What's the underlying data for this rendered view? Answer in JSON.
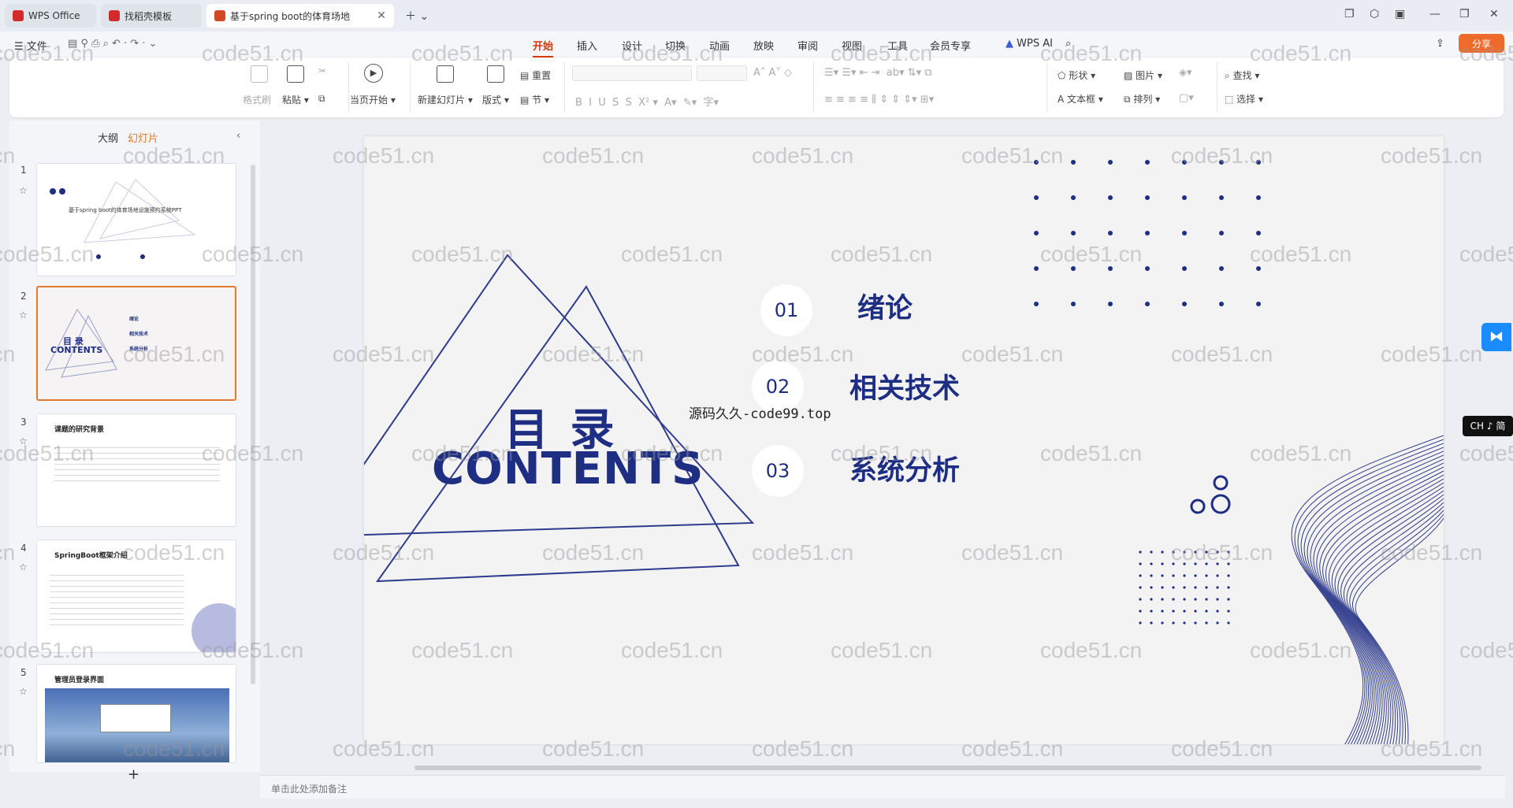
{
  "tabs": [
    {
      "label": "WPS Office",
      "color": "#d12b2b"
    },
    {
      "label": "找稻壳模板",
      "color": "#d12b2b"
    },
    {
      "label": "基于spring boot的体育场地",
      "color": "#d24726"
    }
  ],
  "menu": {
    "file": "文件",
    "items": [
      "开始",
      "插入",
      "设计",
      "切换",
      "动画",
      "放映",
      "审阅",
      "视图",
      "工具",
      "会员专享"
    ],
    "active": "开始",
    "wps_ai": "WPS AI",
    "share": "分享"
  },
  "ribbon": {
    "format_painter": "格式刷",
    "paste": "粘贴",
    "from_current": "当页开始",
    "new_slide": "新建幻灯片",
    "layout": "版式",
    "reset": "重置",
    "section": "节",
    "shape": "形状",
    "picture": "图片",
    "find": "查找",
    "textbox": "文本框",
    "arrange": "排列",
    "select": "选择"
  },
  "panel": {
    "outline": "大纲",
    "slides": "幻灯片",
    "add": "+"
  },
  "thumbs": [
    {
      "num": "1",
      "title": "基于spring boot的体育场地设施预约系统PPT"
    },
    {
      "num": "2",
      "title_cn": "目 录",
      "title_en": "CONTENTS",
      "items": [
        "绪论",
        "相关技术",
        "系统分析"
      ]
    },
    {
      "num": "3",
      "title": "课题的研究背景"
    },
    {
      "num": "4",
      "title": "SpringBoot框架介绍"
    },
    {
      "num": "5",
      "title": "管理员登录界面"
    }
  ],
  "slide": {
    "title_cn": "目 录",
    "title_en": "CONTENTS",
    "items": [
      {
        "num": "01",
        "label": "绪论"
      },
      {
        "num": "02",
        "label": "相关技术"
      },
      {
        "num": "03",
        "label": "系统分析"
      }
    ],
    "overlay_text": "源码久久-code99.top",
    "accent": "#1d2e83"
  },
  "notes": {
    "placeholder": "单击此处添加备注"
  },
  "ime": "CH ♪ 简",
  "watermark": "code51.cn"
}
